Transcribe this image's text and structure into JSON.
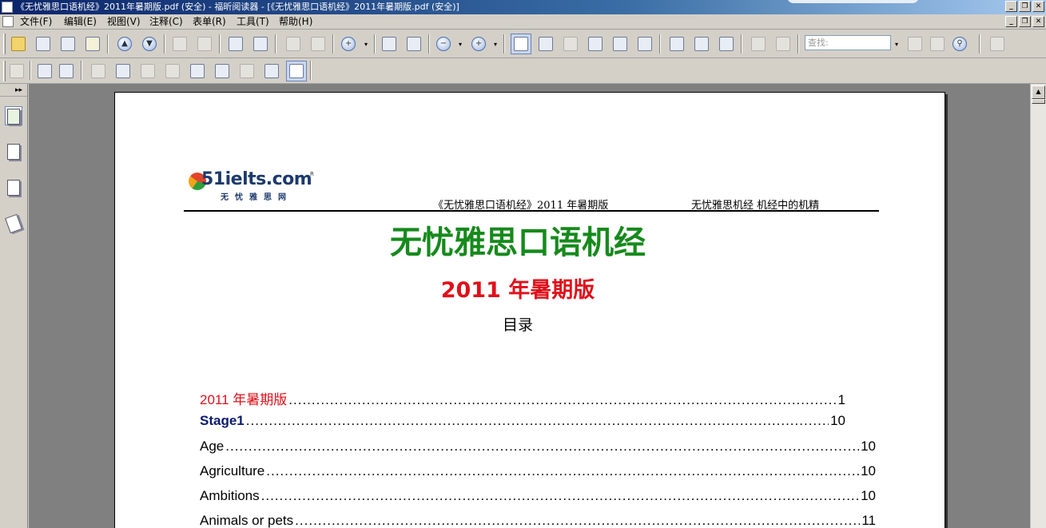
{
  "window": {
    "title": "《无忧雅思口语机经》2011年暑期版.pdf (安全) - 福昕阅读器 - [《无忧雅思口语机经》2011年暑期版.pdf (安全)]",
    "min": "_",
    "restore": "❐",
    "close": "✕"
  },
  "menu": {
    "items": [
      "文件(F)",
      "编辑(E)",
      "视图(V)",
      "注释(C)",
      "表单(R)",
      "工具(T)",
      "帮助(H)"
    ]
  },
  "toolbar": {
    "find_placeholder": "查找:",
    "dropdown_glyph": "▾"
  },
  "sidebar": {
    "expand_glyph": "▸▸"
  },
  "document": {
    "logo_text": "51ielts.com",
    "logo_sub": "无忧雅思网",
    "logo_reg": "R",
    "header_left": "《无忧雅思口语机经》2011 年暑期版",
    "header_right": "无忧雅思机经  机经中的机精",
    "title": "无忧雅思口语机经",
    "subtitle": "2011 年暑期版",
    "toc_heading": "目录",
    "toc": [
      {
        "label": "2011 年暑期版",
        "page": "1"
      },
      {
        "label": "Stage1",
        "page": "10"
      },
      {
        "label": "Age",
        "page": "10"
      },
      {
        "label": "Agriculture",
        "page": "10"
      },
      {
        "label": "Ambitions",
        "page": "10"
      },
      {
        "label": "Animals or pets",
        "page": "11"
      }
    ],
    "dots": "......................................................................................................................................................"
  },
  "scroll": {
    "up": "▲"
  },
  "colors": {
    "title_green": "#168a1c",
    "subtitle_red": "#e0101a",
    "stage_navy": "#0b1a6e"
  }
}
